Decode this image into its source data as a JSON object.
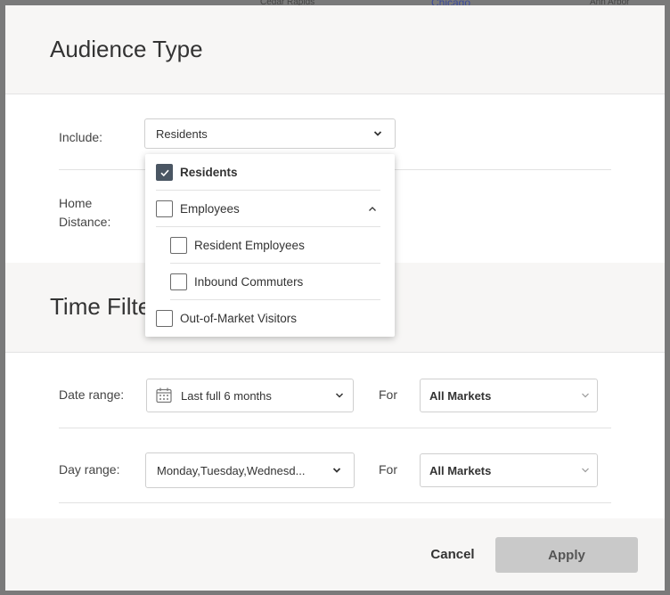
{
  "background": {
    "map_labels": [
      "Cedar Rapids",
      "Chicago",
      "Ann Arbor"
    ]
  },
  "audience_section": {
    "title": "Audience Type",
    "include_label": "Include:",
    "include_select_value": "Residents",
    "home_distance_label_line1": "Home",
    "home_distance_label_line2": "Distance:"
  },
  "include_dropdown": {
    "options": [
      {
        "label": "Residents",
        "checked": true
      },
      {
        "label": "Employees",
        "checked": false,
        "expanded": true
      },
      {
        "label": "Resident Employees",
        "checked": false
      },
      {
        "label": "Inbound Commuters",
        "checked": false
      },
      {
        "label": "Out-of-Market Visitors",
        "checked": false
      }
    ]
  },
  "time_section": {
    "title": "Time Filte",
    "date_range_label": "Date range:",
    "date_range_value": "Last full 6 months",
    "date_for_label": "For",
    "date_markets_value": "All Markets",
    "day_range_label": "Day range:",
    "day_range_value": "Monday,Tuesday,Wednesd...",
    "day_for_label": "For",
    "day_markets_value": "All Markets"
  },
  "footer": {
    "cancel_label": "Cancel",
    "apply_label": "Apply"
  },
  "colors": {
    "checkbox_checked": "#4a5663",
    "apply_disabled": "#c9c9c9",
    "header_bg": "#f7f6f5"
  },
  "icons": {
    "chevron_down": "chevron-down-icon",
    "chevron_up": "chevron-up-icon",
    "calendar": "calendar-icon",
    "check": "check-icon"
  }
}
